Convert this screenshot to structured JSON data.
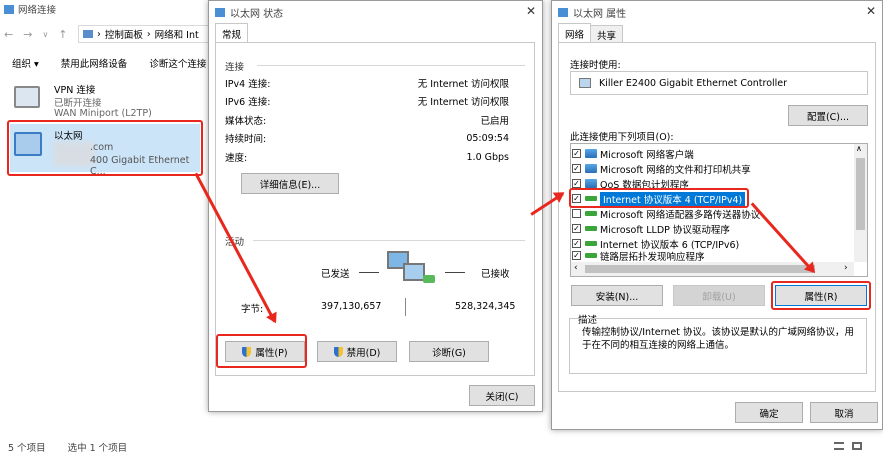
{
  "explorer": {
    "title": "网络连接",
    "crumb_root": "控制面板",
    "crumb_next": "网络和 Int",
    "toolbar": [
      "组织 ▾",
      "禁用此网络设备",
      "诊断这个连接"
    ],
    "items": [
      {
        "name": "VPN 连接",
        "status": "已断开连接",
        "device": "WAN Miniport (L2TP)"
      },
      {
        "name": "以太网",
        "status": ".com",
        "device": "400 Gigabit Ethernet C..."
      }
    ],
    "status_count": "5 个项目",
    "status_selected": "选中 1 个项目"
  },
  "status_dlg": {
    "title": "以太网 状态",
    "tab": "常规",
    "section_conn": "连接",
    "rows": [
      {
        "label": "IPv4 连接:",
        "value": "无 Internet 访问权限"
      },
      {
        "label": "IPv6 连接:",
        "value": "无 Internet 访问权限"
      },
      {
        "label": "媒体状态:",
        "value": "已启用"
      },
      {
        "label": "持续时间:",
        "value": "05:09:54"
      },
      {
        "label": "速度:",
        "value": "1.0 Gbps"
      }
    ],
    "details_btn": "详细信息(E)...",
    "section_activity": "活动",
    "sent_label": "已发送",
    "recv_label": "已接收",
    "bytes_label": "字节:",
    "bytes_sent": "397,130,657",
    "bytes_recv": "528,324,345",
    "prop_btn": "属性(P)",
    "disable_btn": "禁用(D)",
    "diag_btn": "诊断(G)",
    "close_btn": "关闭(C)"
  },
  "prop_dlg": {
    "title": "以太网 属性",
    "tab_net": "网络",
    "tab_share": "共享",
    "connect_using": "连接时使用:",
    "adapter": "Killer E2400 Gigabit Ethernet Controller",
    "config_btn": "配置(C)...",
    "items_label": "此连接使用下列项目(O):",
    "items": [
      {
        "text": "Microsoft 网络客户端",
        "checked": true
      },
      {
        "text": "Microsoft 网络的文件和打印机共享",
        "checked": true
      },
      {
        "text": "QoS 数据包计划程序",
        "checked": true
      },
      {
        "text": "Internet 协议版本 4 (TCP/IPv4)",
        "checked": true
      },
      {
        "text": "Microsoft 网络适配器多路传送器协议",
        "checked": false
      },
      {
        "text": "Microsoft LLDP 协议驱动程序",
        "checked": true
      },
      {
        "text": "Internet 协议版本 6 (TCP/IPv6)",
        "checked": true
      },
      {
        "text": "链路层拓扑发现响应程序",
        "checked": true
      }
    ],
    "install_btn": "安装(N)...",
    "uninstall_btn": "卸载(U)",
    "prop_btn": "属性(R)",
    "desc_label": "描述",
    "desc_text": "传输控制协议/Internet 协议。该协议是默认的广域网络协议，用于在不同的相互连接的网络上通信。",
    "ok_btn": "确定",
    "cancel_btn": "取消"
  }
}
